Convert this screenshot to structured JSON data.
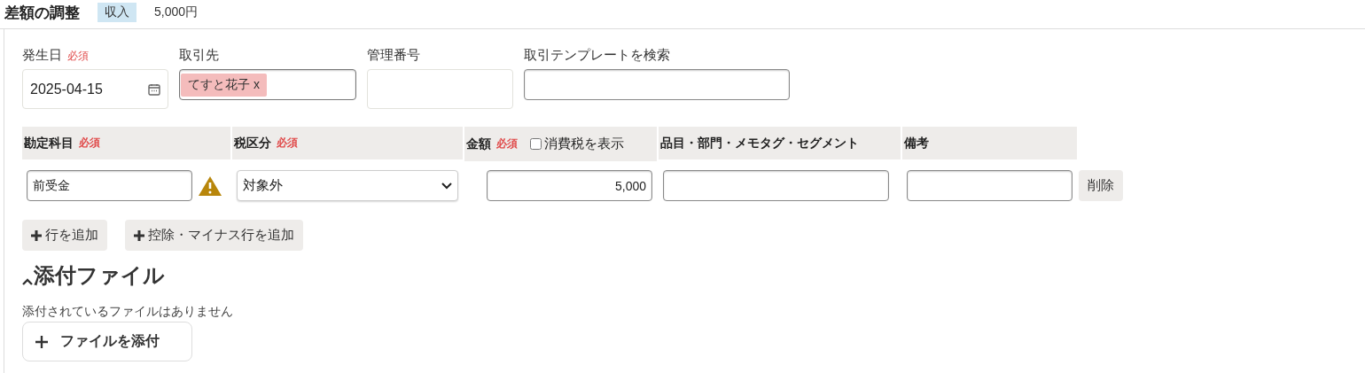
{
  "title": "差額の調整",
  "badge": "収入",
  "amount": "5,000円",
  "fields": [
    {
      "kind": "date",
      "label": "発生日",
      "required_label": "必須",
      "value": "2025-04-15"
    },
    {
      "kind": "tags",
      "label": "取引先",
      "tags": [
        {
          "text": "てすと花子",
          "remove": "x"
        }
      ]
    },
    {
      "kind": "text",
      "label": "管理番号"
    },
    {
      "kind": "search",
      "label": "取引テンプレートを検索"
    }
  ],
  "columns": [
    {
      "label": "勘定科目",
      "required_label": "必須"
    },
    {
      "label": "税区分",
      "required_label": "必須"
    },
    {
      "label": "金額",
      "required_label": "必須",
      "checkbox": {
        "label": "消費税を表示",
        "checked": false
      }
    },
    {
      "label": "品目・部門・メモタグ・セグメント"
    },
    {
      "label": "備考"
    }
  ],
  "rows": [
    {
      "account": "前受金",
      "warning": true,
      "tax": "対象外",
      "amount": "5,000",
      "delete": "削除"
    }
  ],
  "add_buttons": [
    "行を追加",
    "控除・マイナス行を追加"
  ],
  "attachments": {
    "heading": "添付ファイル",
    "expanded": true,
    "empty_text": "添付されているファイルはありません",
    "button": "ファイルを添付"
  }
}
